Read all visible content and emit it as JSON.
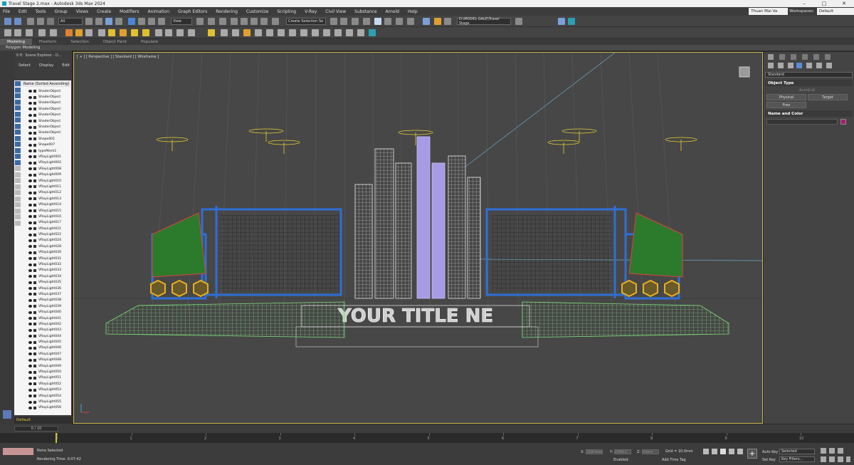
{
  "window": {
    "title": "Travel Stage 2.max - Autodesk 3ds Max 2024",
    "controls": [
      "–",
      "□",
      "✕"
    ]
  },
  "menu": {
    "items": [
      "File",
      "Edit",
      "Tools",
      "Group",
      "Views",
      "Create",
      "Modifiers",
      "Animation",
      "Graph Editors",
      "Rendering",
      "Customize",
      "Scripting",
      "V-Ray",
      "Civil View",
      "Substance",
      "Arnold",
      "Help"
    ],
    "user": "Thuan Mai Va",
    "workspaces_label": "Workspaces:",
    "workspace_value": "Default"
  },
  "toolbar": {
    "selection_filter": "All",
    "ref_coord": "View",
    "named_selection": "Create Selection Se",
    "project_path": "D:\\MODEL GALE\\Travel Stage"
  },
  "ribbon": {
    "tabs": [
      "Modeling",
      "Freeform",
      "Selection",
      "Object Paint",
      "Populate"
    ],
    "sub_label": "Polygon Modeling"
  },
  "scene_explorer": {
    "title": "Scene Explorer - D...",
    "tab_prefix": "0 ft",
    "menu": [
      "Select",
      "Display",
      "Edit"
    ],
    "column_header": "Name (Sorted Ascending)",
    "rows": [
      "ShaderObject",
      "ShaderObject",
      "ShaderObject",
      "ShaderObject",
      "ShaderObject",
      "ShaderObject",
      "ShaderObject",
      "ShaderObject",
      "Shape001",
      "Shape007",
      "typeMesh1",
      "VRayLight001",
      "VRayLight002",
      "VRayLight008",
      "VRayLight009",
      "VRayLight010",
      "VRayLight011",
      "VRayLight012",
      "VRayLight013",
      "VRayLight014",
      "VRayLight015",
      "VRayLight016",
      "VRayLight017",
      "VRayLight021",
      "VRayLight022",
      "VRayLight024",
      "VRayLight028",
      "VRayLight030",
      "VRayLight031",
      "VRayLight032",
      "VRayLight033",
      "VRayLight034",
      "VRayLight035",
      "VRayLight036",
      "VRayLight037",
      "VRayLight038",
      "VRayLight039",
      "VRayLight040",
      "VRayLight041",
      "VRayLight042",
      "VRayLight043",
      "VRayLight044",
      "VRayLight045",
      "VRayLight046",
      "VRayLight047",
      "VRayLight048",
      "VRayLight049",
      "VRayLight050",
      "VRayLight051",
      "VRayLight052",
      "VRayLight053",
      "VRayLight054",
      "VRayLight055",
      "VRayLight056"
    ],
    "layer": "Default"
  },
  "viewport": {
    "label": "[ + ] [ Perspective ] [ Standard ] [ Wireframe ]",
    "title_text": "YOUR TITLE NE",
    "wire_color": "#7fe07a",
    "frame_color": "#2f6fd6",
    "tower_color": "#e6e6e6",
    "accent_tower_color": "#a79be6"
  },
  "command_panel": {
    "category": "Standard",
    "object_type_header": "Object Type",
    "autogrid": "AutoGrid",
    "buttons": [
      "Physical",
      "Target",
      "Free"
    ],
    "name_color_header": "Name and Color",
    "swatch_color": "#b0196d"
  },
  "timeline": {
    "frame_display": "0 / 10",
    "ticks": [
      "0",
      "1",
      "2",
      "3",
      "4",
      "5",
      "6",
      "7",
      "8",
      "9",
      "10"
    ]
  },
  "status": {
    "selection": "None Selected",
    "render_time": "Rendering Time: 0:07:42",
    "x_label": "X:",
    "x_value": "1206.0mm",
    "y_label": "Y:",
    "y_value": "27990.2",
    "z_label": "Z:",
    "z_value": "0.0mm",
    "grid": "Grid = 10.0mm",
    "enabled_label": "Enabled:",
    "add_time_tag": "Add Time Tag",
    "auto_key": "Auto Key",
    "set_key": "Set Key",
    "key_filters": "Key Filters...",
    "selected_option": "Selected"
  }
}
